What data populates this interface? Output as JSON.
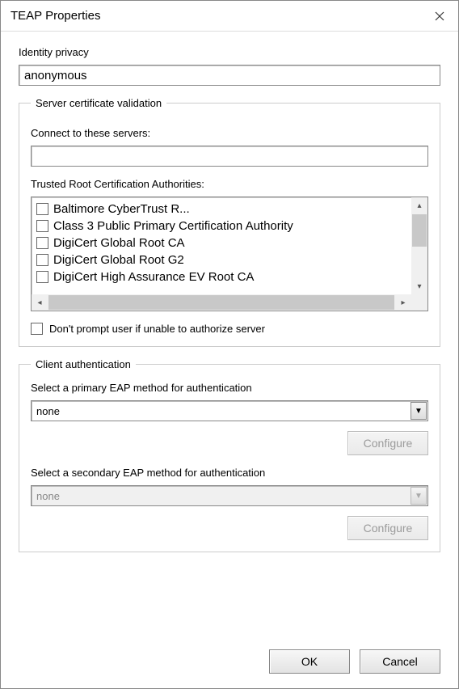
{
  "window": {
    "title": "TEAP Properties"
  },
  "identity": {
    "label": "Identity privacy",
    "value": "anonymous"
  },
  "server_validation": {
    "legend": "Server certificate validation",
    "connect_label": "Connect to these servers:",
    "connect_value": "",
    "ca_label": "Trusted Root Certification Authorities:",
    "ca_list": [
      "Baltimore CyberTrust R...",
      "Class 3 Public Primary Certification Authority",
      "DigiCert Global Root CA",
      "DigiCert Global Root G2",
      "DigiCert High Assurance EV Root CA"
    ],
    "dont_prompt_label": "Don't prompt user if unable to authorize server"
  },
  "client_auth": {
    "legend": "Client authentication",
    "primary_label": "Select a primary EAP method for authentication",
    "primary_value": "none",
    "secondary_label": "Select a secondary EAP method for authentication",
    "secondary_value": "none",
    "configure_label": "Configure"
  },
  "buttons": {
    "ok": "OK",
    "cancel": "Cancel"
  }
}
